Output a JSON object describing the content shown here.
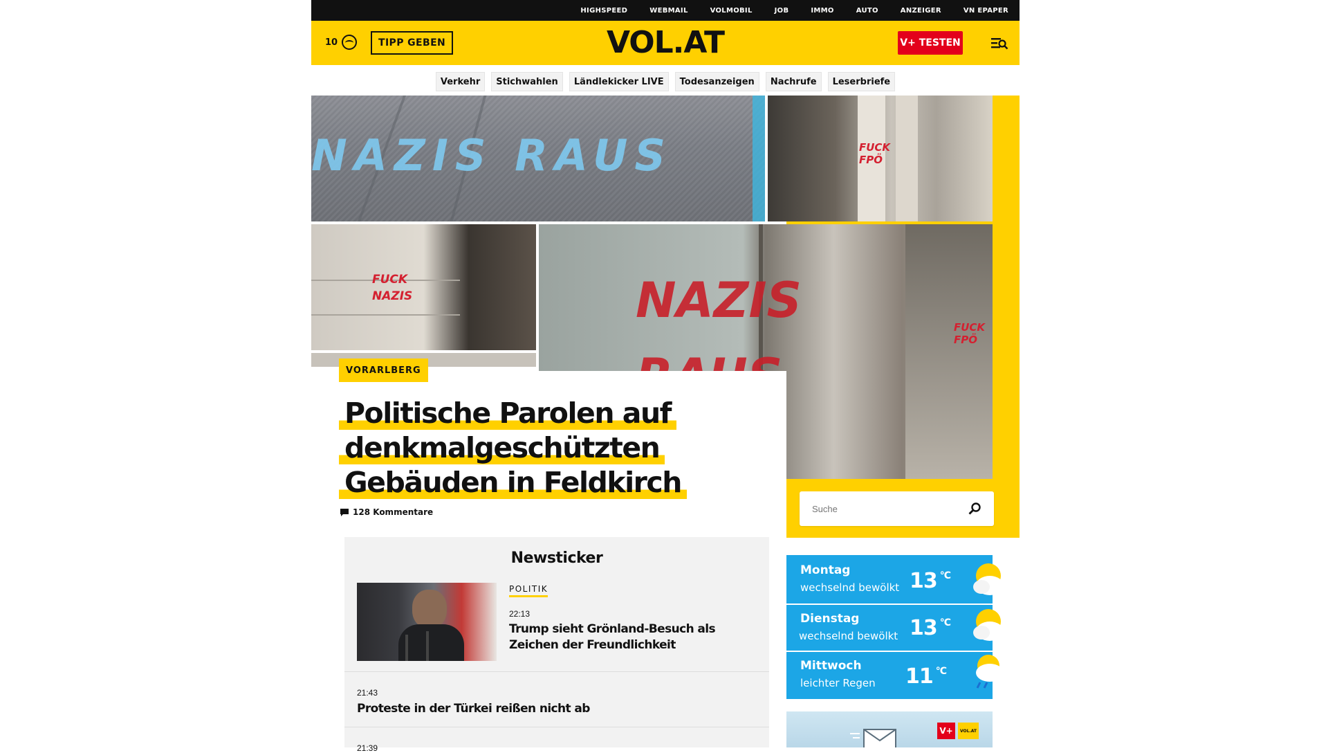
{
  "topbar": {
    "links": [
      "HIGHSPEED",
      "WEBMAIL",
      "VOLMOBIL",
      "JOB",
      "IMMO",
      "AUTO",
      "ANZEIGER",
      "VN EPAPER"
    ]
  },
  "header": {
    "weather_temp": "10",
    "tip_label": "TIPP GEBEN",
    "logo": "VOL.AT",
    "vplus_label": "V+ TESTEN",
    "menu_icon": "menu-search-icon",
    "accent_color": "#ffd000",
    "vplus_color": "#e3001b"
  },
  "categories": [
    "Verkehr",
    "Stichwahlen",
    "Ländlekicker LIVE",
    "Todesanzeigen",
    "Nachrufe",
    "Leserbriefe"
  ],
  "hero": {
    "category": "VORARLBERG",
    "headline": "Politische Parolen auf denkmalgeschützten Gebäuden in Feldkirch",
    "comments": "128 Kommentare",
    "graffiti": [
      "NAZIS RAUS",
      "FUCK FPÖ",
      "FUCK NAZIS",
      "NAZIS RAUS",
      "FUCK FPÖ"
    ]
  },
  "search": {
    "placeholder": "Suche",
    "icon": "search-icon"
  },
  "newsticker": {
    "title": "Newsticker",
    "items": [
      {
        "category": "POLITIK",
        "time": "22:13",
        "title": "Trump sieht Grönland-Besuch als Zeichen der Freundlichkeit"
      },
      {
        "time": "21:43",
        "title": "Proteste in der Türkei reißen nicht ab"
      },
      {
        "time": "21:39"
      }
    ]
  },
  "weather": [
    {
      "day": "Montag",
      "condition": "wechselnd bewölkt",
      "temp": "13",
      "unit": "°C",
      "icon": "partly-cloudy-icon"
    },
    {
      "day": "Dienstag",
      "condition": "wechselnd bewölkt",
      "temp": "13",
      "unit": "°C",
      "icon": "partly-cloudy-icon"
    },
    {
      "day": "Mittwoch",
      "condition": "leichter Regen",
      "temp": "11",
      "unit": "°C",
      "icon": "light-rain-icon"
    }
  ],
  "promo": {
    "badge_vplus": "V+",
    "badge_volat": "VOL.AT",
    "icon": "envelope-icon"
  }
}
